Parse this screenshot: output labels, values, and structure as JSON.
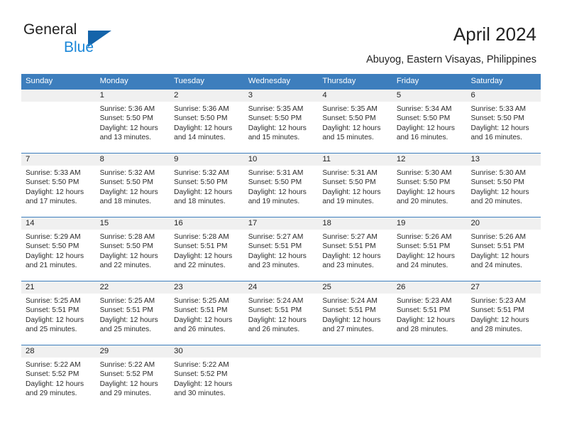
{
  "brand": {
    "name_part1": "General",
    "name_part2": "Blue",
    "triangle_color": "#1464aa",
    "blue_color": "#1b87d8"
  },
  "header": {
    "title": "April 2024",
    "subtitle": "Abuyog, Eastern Visayas, Philippines"
  },
  "theme": {
    "header_blue": "#3d7ebd",
    "daynum_background": "#f0f0f0"
  },
  "weekdays": [
    "Sunday",
    "Monday",
    "Tuesday",
    "Wednesday",
    "Thursday",
    "Friday",
    "Saturday"
  ],
  "weeks": [
    {
      "days": [
        {
          "num": "",
          "sunrise": "",
          "sunset": "",
          "daylight1": "",
          "daylight2": ""
        },
        {
          "num": "1",
          "sunrise": "Sunrise: 5:36 AM",
          "sunset": "Sunset: 5:50 PM",
          "daylight1": "Daylight: 12 hours",
          "daylight2": "and 13 minutes."
        },
        {
          "num": "2",
          "sunrise": "Sunrise: 5:36 AM",
          "sunset": "Sunset: 5:50 PM",
          "daylight1": "Daylight: 12 hours",
          "daylight2": "and 14 minutes."
        },
        {
          "num": "3",
          "sunrise": "Sunrise: 5:35 AM",
          "sunset": "Sunset: 5:50 PM",
          "daylight1": "Daylight: 12 hours",
          "daylight2": "and 15 minutes."
        },
        {
          "num": "4",
          "sunrise": "Sunrise: 5:35 AM",
          "sunset": "Sunset: 5:50 PM",
          "daylight1": "Daylight: 12 hours",
          "daylight2": "and 15 minutes."
        },
        {
          "num": "5",
          "sunrise": "Sunrise: 5:34 AM",
          "sunset": "Sunset: 5:50 PM",
          "daylight1": "Daylight: 12 hours",
          "daylight2": "and 16 minutes."
        },
        {
          "num": "6",
          "sunrise": "Sunrise: 5:33 AM",
          "sunset": "Sunset: 5:50 PM",
          "daylight1": "Daylight: 12 hours",
          "daylight2": "and 16 minutes."
        }
      ]
    },
    {
      "days": [
        {
          "num": "7",
          "sunrise": "Sunrise: 5:33 AM",
          "sunset": "Sunset: 5:50 PM",
          "daylight1": "Daylight: 12 hours",
          "daylight2": "and 17 minutes."
        },
        {
          "num": "8",
          "sunrise": "Sunrise: 5:32 AM",
          "sunset": "Sunset: 5:50 PM",
          "daylight1": "Daylight: 12 hours",
          "daylight2": "and 18 minutes."
        },
        {
          "num": "9",
          "sunrise": "Sunrise: 5:32 AM",
          "sunset": "Sunset: 5:50 PM",
          "daylight1": "Daylight: 12 hours",
          "daylight2": "and 18 minutes."
        },
        {
          "num": "10",
          "sunrise": "Sunrise: 5:31 AM",
          "sunset": "Sunset: 5:50 PM",
          "daylight1": "Daylight: 12 hours",
          "daylight2": "and 19 minutes."
        },
        {
          "num": "11",
          "sunrise": "Sunrise: 5:31 AM",
          "sunset": "Sunset: 5:50 PM",
          "daylight1": "Daylight: 12 hours",
          "daylight2": "and 19 minutes."
        },
        {
          "num": "12",
          "sunrise": "Sunrise: 5:30 AM",
          "sunset": "Sunset: 5:50 PM",
          "daylight1": "Daylight: 12 hours",
          "daylight2": "and 20 minutes."
        },
        {
          "num": "13",
          "sunrise": "Sunrise: 5:30 AM",
          "sunset": "Sunset: 5:50 PM",
          "daylight1": "Daylight: 12 hours",
          "daylight2": "and 20 minutes."
        }
      ]
    },
    {
      "days": [
        {
          "num": "14",
          "sunrise": "Sunrise: 5:29 AM",
          "sunset": "Sunset: 5:50 PM",
          "daylight1": "Daylight: 12 hours",
          "daylight2": "and 21 minutes."
        },
        {
          "num": "15",
          "sunrise": "Sunrise: 5:28 AM",
          "sunset": "Sunset: 5:50 PM",
          "daylight1": "Daylight: 12 hours",
          "daylight2": "and 22 minutes."
        },
        {
          "num": "16",
          "sunrise": "Sunrise: 5:28 AM",
          "sunset": "Sunset: 5:51 PM",
          "daylight1": "Daylight: 12 hours",
          "daylight2": "and 22 minutes."
        },
        {
          "num": "17",
          "sunrise": "Sunrise: 5:27 AM",
          "sunset": "Sunset: 5:51 PM",
          "daylight1": "Daylight: 12 hours",
          "daylight2": "and 23 minutes."
        },
        {
          "num": "18",
          "sunrise": "Sunrise: 5:27 AM",
          "sunset": "Sunset: 5:51 PM",
          "daylight1": "Daylight: 12 hours",
          "daylight2": "and 23 minutes."
        },
        {
          "num": "19",
          "sunrise": "Sunrise: 5:26 AM",
          "sunset": "Sunset: 5:51 PM",
          "daylight1": "Daylight: 12 hours",
          "daylight2": "and 24 minutes."
        },
        {
          "num": "20",
          "sunrise": "Sunrise: 5:26 AM",
          "sunset": "Sunset: 5:51 PM",
          "daylight1": "Daylight: 12 hours",
          "daylight2": "and 24 minutes."
        }
      ]
    },
    {
      "days": [
        {
          "num": "21",
          "sunrise": "Sunrise: 5:25 AM",
          "sunset": "Sunset: 5:51 PM",
          "daylight1": "Daylight: 12 hours",
          "daylight2": "and 25 minutes."
        },
        {
          "num": "22",
          "sunrise": "Sunrise: 5:25 AM",
          "sunset": "Sunset: 5:51 PM",
          "daylight1": "Daylight: 12 hours",
          "daylight2": "and 25 minutes."
        },
        {
          "num": "23",
          "sunrise": "Sunrise: 5:25 AM",
          "sunset": "Sunset: 5:51 PM",
          "daylight1": "Daylight: 12 hours",
          "daylight2": "and 26 minutes."
        },
        {
          "num": "24",
          "sunrise": "Sunrise: 5:24 AM",
          "sunset": "Sunset: 5:51 PM",
          "daylight1": "Daylight: 12 hours",
          "daylight2": "and 26 minutes."
        },
        {
          "num": "25",
          "sunrise": "Sunrise: 5:24 AM",
          "sunset": "Sunset: 5:51 PM",
          "daylight1": "Daylight: 12 hours",
          "daylight2": "and 27 minutes."
        },
        {
          "num": "26",
          "sunrise": "Sunrise: 5:23 AM",
          "sunset": "Sunset: 5:51 PM",
          "daylight1": "Daylight: 12 hours",
          "daylight2": "and 28 minutes."
        },
        {
          "num": "27",
          "sunrise": "Sunrise: 5:23 AM",
          "sunset": "Sunset: 5:51 PM",
          "daylight1": "Daylight: 12 hours",
          "daylight2": "and 28 minutes."
        }
      ]
    },
    {
      "days": [
        {
          "num": "28",
          "sunrise": "Sunrise: 5:22 AM",
          "sunset": "Sunset: 5:52 PM",
          "daylight1": "Daylight: 12 hours",
          "daylight2": "and 29 minutes."
        },
        {
          "num": "29",
          "sunrise": "Sunrise: 5:22 AM",
          "sunset": "Sunset: 5:52 PM",
          "daylight1": "Daylight: 12 hours",
          "daylight2": "and 29 minutes."
        },
        {
          "num": "30",
          "sunrise": "Sunrise: 5:22 AM",
          "sunset": "Sunset: 5:52 PM",
          "daylight1": "Daylight: 12 hours",
          "daylight2": "and 30 minutes."
        },
        {
          "num": "",
          "sunrise": "",
          "sunset": "",
          "daylight1": "",
          "daylight2": ""
        },
        {
          "num": "",
          "sunrise": "",
          "sunset": "",
          "daylight1": "",
          "daylight2": ""
        },
        {
          "num": "",
          "sunrise": "",
          "sunset": "",
          "daylight1": "",
          "daylight2": ""
        },
        {
          "num": "",
          "sunrise": "",
          "sunset": "",
          "daylight1": "",
          "daylight2": ""
        }
      ]
    }
  ]
}
